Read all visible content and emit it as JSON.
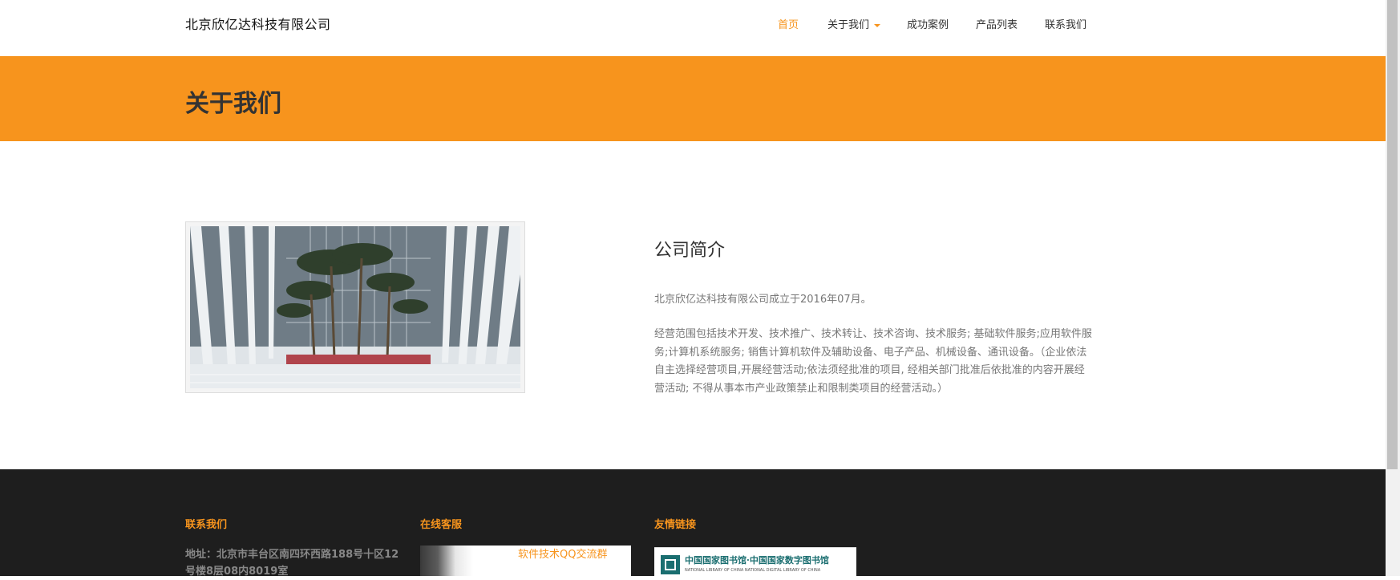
{
  "header": {
    "logo": "北京欣亿达科技有限公司",
    "nav": [
      {
        "label": "首页",
        "active": true
      },
      {
        "label": "关于我们",
        "dropdown": true
      },
      {
        "label": "成功案例"
      },
      {
        "label": "产品列表"
      },
      {
        "label": "联系我们"
      }
    ]
  },
  "banner": {
    "title": "关于我们"
  },
  "intro": {
    "title": "公司简介",
    "p1": "北京欣亿达科技有限公司成立于2016年07月。",
    "p2": "经营范围包括技术开发、技术推广、技术转让、技术咨询、技术服务; 基础软件服务;应用软件服务;计算机系统服务; 销售计算机软件及辅助设备、电子产品、机械设备、通讯设备。（企业依法自主选择经营项目,开展经营活动;依法须经批准的项目, 经相关部门批准后依批准的内容开展经营活动; 不得从事本市产业政策禁止和限制类项目的经营活动。）"
  },
  "footer": {
    "contact": {
      "heading": "联系我们",
      "address": "地址：北京市丰台区南四环西路188号十区12号楼8层08内8019室"
    },
    "service": {
      "heading": "在线客服",
      "banner_text": "软件技术QQ交流群"
    },
    "links": {
      "heading": "友情链接",
      "library_cn": "中国国家图书馆·中国国家数字图书馆",
      "library_en": "NATIONAL LIBRARY OF CHINA    NATIONAL DIGITAL LIBRARY OF CHINA"
    }
  },
  "colors": {
    "accent": "#f7941d",
    "footer_bg": "#1e1e1e",
    "library_teal": "#1a6e70"
  }
}
